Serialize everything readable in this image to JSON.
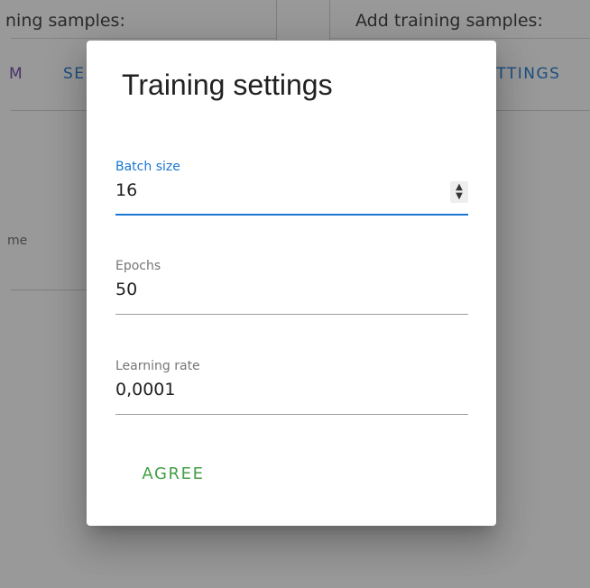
{
  "background": {
    "left_panel": {
      "title": "ning samples:",
      "tab_1": "M",
      "tab_2": "SE",
      "field_label_fragment": "me"
    },
    "right_panel": {
      "title": "Add training samples:",
      "tab_settings": "ETTINGS"
    }
  },
  "dialog": {
    "title": "Training settings",
    "fields": [
      {
        "label": "Batch size",
        "value": "16",
        "focused": true
      },
      {
        "label": "Epochs",
        "value": "50",
        "focused": false
      },
      {
        "label": "Learning rate",
        "value": "0,0001",
        "focused": false
      }
    ],
    "agree_label": "AGREE"
  },
  "colors": {
    "primary": "#1976d2",
    "accent_purple": "#6a3fa3",
    "agree_green": "#43a047",
    "scrim": "rgba(33,33,33,0.46)"
  }
}
